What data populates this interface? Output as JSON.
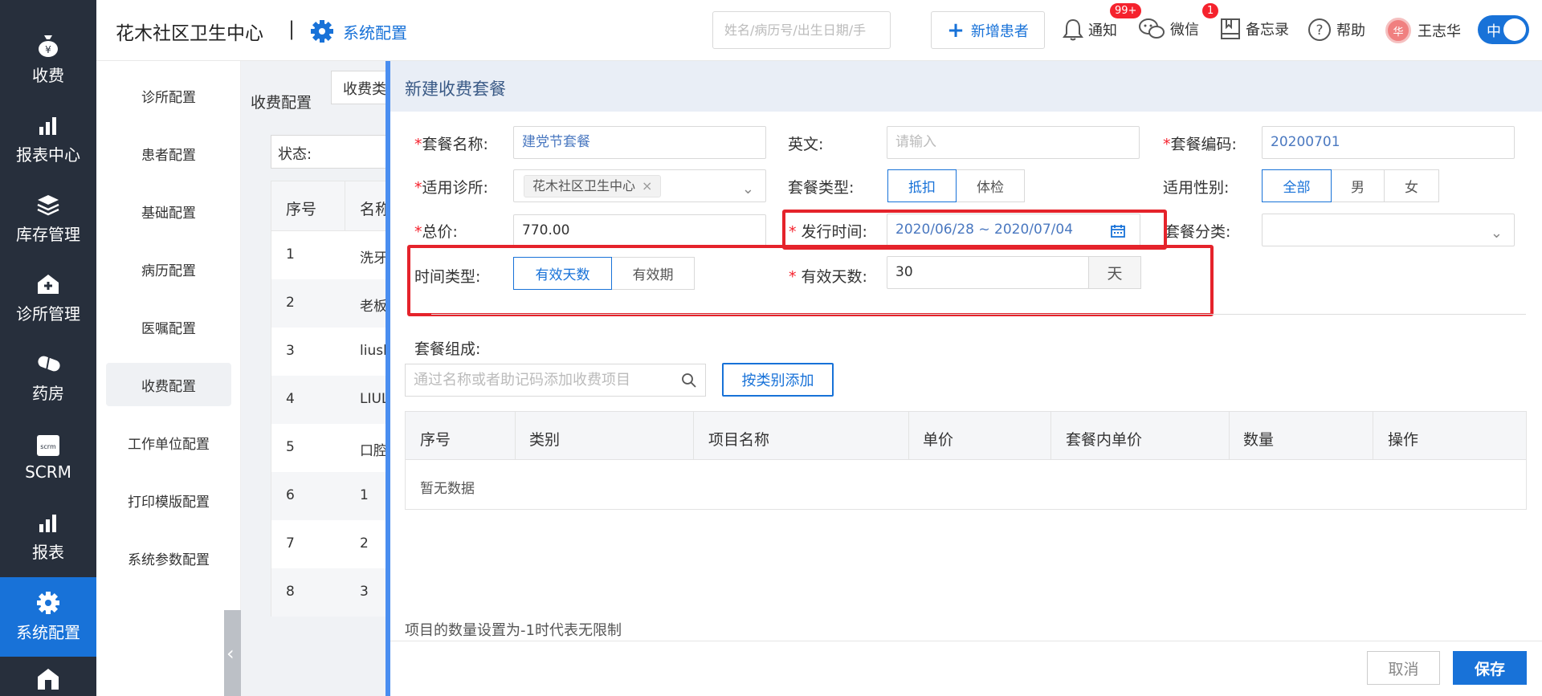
{
  "nav": {
    "items": [
      {
        "label": "收费",
        "icon": "money-bag-icon"
      },
      {
        "label": "报表中心",
        "icon": "bar-chart-icon"
      },
      {
        "label": "库存管理",
        "icon": "layers-icon"
      },
      {
        "label": "诊所管理",
        "icon": "clinic-house-icon"
      },
      {
        "label": "药房",
        "icon": "pill-icon"
      },
      {
        "label": "SCRM",
        "icon": "scrm-icon"
      },
      {
        "label": "报表",
        "icon": "bar-chart-icon"
      },
      {
        "label": "系统配置",
        "icon": "gear-icon"
      }
    ],
    "active": "系统配置"
  },
  "header": {
    "clinic_name": "花木社区卫生中心",
    "separator": "|",
    "section": "系统配置",
    "search_placeholder": "姓名/病历号/出生日期/手",
    "new_patient": "新增患者",
    "notify": {
      "label": "通知",
      "badge": "99+"
    },
    "wechat": {
      "label": "微信",
      "badge": "1"
    },
    "memo": "备忘录",
    "help": "帮助",
    "user": {
      "name": "王志华",
      "avatar": "华"
    },
    "lang": "中"
  },
  "submenu": {
    "items": [
      "诊所配置",
      "患者配置",
      "基础配置",
      "病历配置",
      "医嘱配置",
      "收费配置",
      "工作单位配置",
      "打印模版配置",
      "系统参数配置"
    ],
    "active": "收费配置"
  },
  "background": {
    "title": "收费配置",
    "tab": "收费类",
    "filter_label": "状态:",
    "table_headers": [
      "序号",
      "名称"
    ],
    "rows": [
      [
        "1",
        "洗牙"
      ],
      [
        "2",
        "老板"
      ],
      [
        "3",
        "liush"
      ],
      [
        "4",
        "LIUL"
      ],
      [
        "5",
        "口腔"
      ],
      [
        "6",
        "1"
      ],
      [
        "7",
        "2"
      ],
      [
        "8",
        "3"
      ]
    ]
  },
  "drawer": {
    "title": "新建收费套餐",
    "fields": {
      "name_label": "套餐名称:",
      "name_value": "建党节套餐",
      "english_label": "英文:",
      "english_placeholder": "请输入",
      "code_label": "套餐编码:",
      "code_value": "20200701",
      "clinic_label": "适用诊所:",
      "clinic_tag": "花木社区卫生中心",
      "type_label": "套餐类型:",
      "type_options": [
        "抵扣",
        "体检"
      ],
      "type_selected": "抵扣",
      "gender_label": "适用性别:",
      "gender_options": [
        "全部",
        "男",
        "女"
      ],
      "gender_selected": "全部",
      "price_label": "总价:",
      "price_value": "770.00",
      "release_label": "发行时间:",
      "release_value": "2020/06/28 ~ 2020/07/04",
      "category_label": "套餐分类:",
      "time_type_label": "时间类型:",
      "time_type_options": [
        "有效天数",
        "有效期"
      ],
      "time_type_selected": "有效天数",
      "valid_days_label": "有效天数:",
      "valid_days_value": "30",
      "valid_days_unit": "天"
    },
    "composition": {
      "label": "套餐组成:",
      "search_placeholder": "通过名称或者助记码添加收费项目",
      "add_by_category": "按类别添加",
      "headers": [
        "序号",
        "类别",
        "项目名称",
        "单价",
        "套餐内单价",
        "数量",
        "操作"
      ],
      "empty_text": "暂无数据"
    },
    "note": "项目的数量设置为-1时代表无限制",
    "cancel": "取消",
    "save": "保存"
  },
  "colors": {
    "primary": "#1872d8",
    "nav_bg": "#272f3c",
    "highlight_red": "#e5232b",
    "required_red": "#f5222d"
  }
}
